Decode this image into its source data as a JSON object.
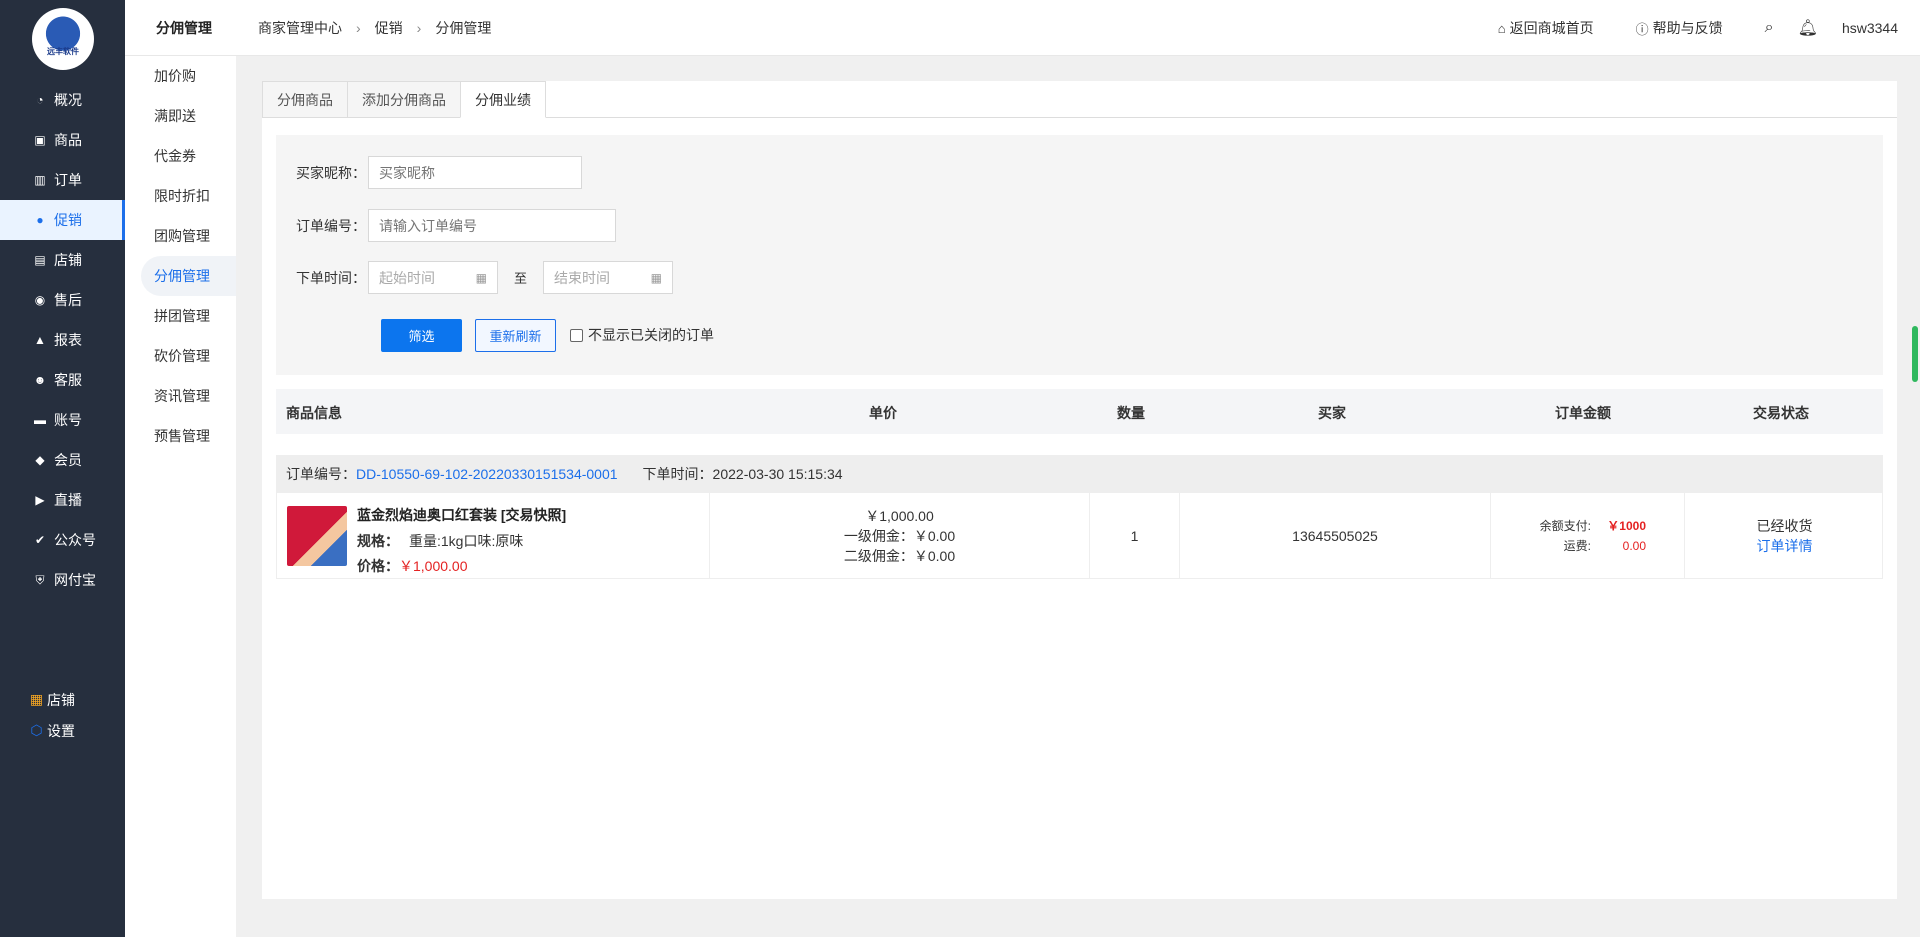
{
  "logo": {
    "text": "远丰软件"
  },
  "sidebar": {
    "items": [
      {
        "label": "概况",
        "icon": "dashboard-icon",
        "glyph": "◔"
      },
      {
        "label": "商品",
        "icon": "bag-icon",
        "glyph": "▣"
      },
      {
        "label": "订单",
        "icon": "bar-chart-icon",
        "glyph": "▥"
      },
      {
        "label": "促销",
        "icon": "promotion-icon",
        "glyph": "●"
      },
      {
        "label": "店铺",
        "icon": "store-icon",
        "glyph": "▤"
      },
      {
        "label": "售后",
        "icon": "aftersale-icon",
        "glyph": "◉"
      },
      {
        "label": "报表",
        "icon": "report-icon",
        "glyph": "▲"
      },
      {
        "label": "客服",
        "icon": "service-icon",
        "glyph": "☻"
      },
      {
        "label": "账号",
        "icon": "card-icon",
        "glyph": "▬"
      },
      {
        "label": "会员",
        "icon": "diamond-icon",
        "glyph": "◆"
      },
      {
        "label": "直播",
        "icon": "live-icon",
        "glyph": "▶"
      },
      {
        "label": "公众号",
        "icon": "wechat-icon",
        "glyph": "✔"
      },
      {
        "label": "网付宝",
        "icon": "shield-icon",
        "glyph": "⛨"
      }
    ],
    "active_index": 3,
    "bottom": [
      {
        "label": "店铺",
        "icon": "grid-icon",
        "glyph": "▦"
      },
      {
        "label": "设置",
        "icon": "settings-icon",
        "glyph": "⬡"
      }
    ]
  },
  "subnav": {
    "items": [
      "加价购",
      "满即送",
      "代金券",
      "限时折扣",
      "团购管理",
      "分佣管理",
      "拼团管理",
      "砍价管理",
      "资讯管理",
      "预售管理"
    ],
    "active_index": 5
  },
  "header": {
    "title": "分佣管理",
    "breadcrumb": [
      "商家管理中心",
      "促销",
      "分佣管理"
    ],
    "back_link": "返回商城首页",
    "help_link": "帮助与反馈",
    "username": "hsw3344"
  },
  "tabs": [
    "分佣商品",
    "添加分佣商品",
    "分佣业绩"
  ],
  "active_tab": 2,
  "filter": {
    "buyer_label": "买家昵称：",
    "buyer_placeholder": "买家昵称",
    "order_label": "订单编号：",
    "order_placeholder": "请输入订单编号",
    "time_label": "下单时间：",
    "start_placeholder": "起始时间",
    "to_label": "至",
    "end_placeholder": "结束时间",
    "filter_button": "筛选",
    "reset_button": "重新刷新",
    "hide_closed_label": "不显示已关闭的订单"
  },
  "table": {
    "headers": [
      "商品信息",
      "单价",
      "数量",
      "买家",
      "订单金额",
      "交易状态"
    ]
  },
  "order": {
    "no_label": "订单编号：",
    "no": "DD-10550-69-102-20220330151534-0001",
    "time_label": "下单时间：",
    "time": "2022-03-30 15:15:34",
    "product_name": "蓝金烈焰迪奥口红套装 [交易快照]",
    "spec_label": "规格：",
    "spec": "重量:1kg口味:原味",
    "price_label": "价格：",
    "price": "￥1,000.00",
    "unit_price": "￥1,000.00",
    "commission1": "一级佣金：￥0.00",
    "commission2": "二级佣金：￥0.00",
    "quantity": "1",
    "buyer": "13645505025",
    "balance_label": "余额支付:",
    "balance": "￥1000",
    "freight_label": "运费:",
    "freight": "0.00",
    "status": "已经收货",
    "detail_link": "订单详情"
  }
}
